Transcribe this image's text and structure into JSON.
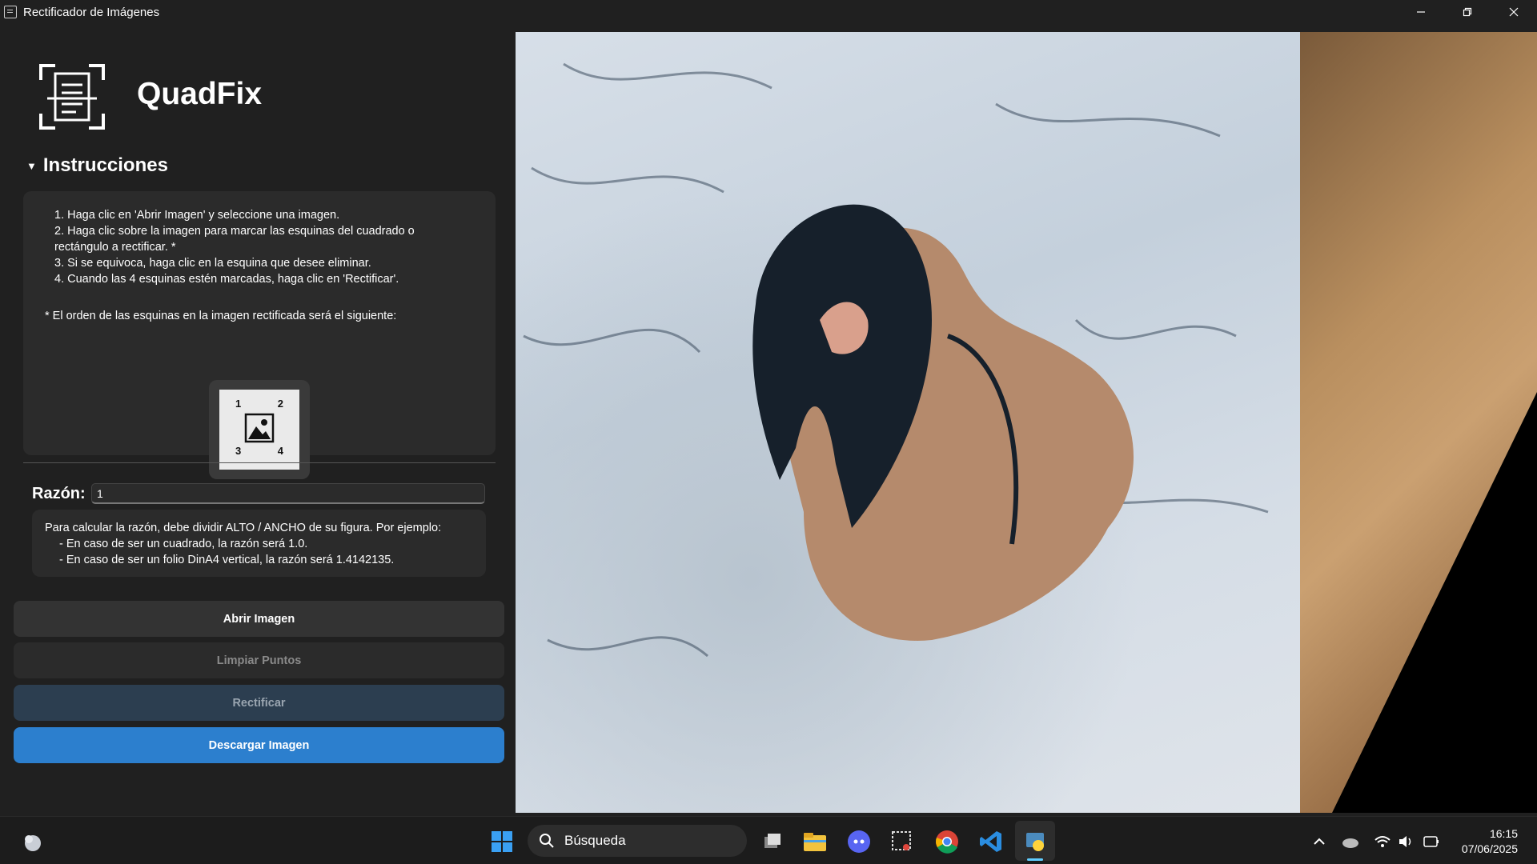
{
  "window": {
    "title": "Rectificador de Imágenes"
  },
  "app": {
    "brand": "QuadFix"
  },
  "instructions": {
    "header": "Instrucciones",
    "steps": [
      "1. Haga clic en 'Abrir Imagen' y seleccione una imagen.",
      "2. Haga clic sobre la imagen para marcar las esquinas del cuadrado o",
      "rectángulo a rectificar. *",
      "3. Si se equivoca, haga clic en la esquina que desee eliminar.",
      "4. Cuando las 4 esquinas estén marcadas, haga clic en 'Rectificar'."
    ],
    "order_note": "* El orden de las esquinas en la imagen rectificada será el siguiente:",
    "corners": [
      "1",
      "2",
      "3",
      "4"
    ]
  },
  "ratio": {
    "label": "Razón:",
    "value": "1",
    "info": [
      "Para calcular la razón, debe dividir ALTO / ANCHO de su figura. Por ejemplo:",
      "-    En caso de ser un cuadrado, la razón será 1.0.",
      "-    En caso de ser un folio DinA4 vertical, la razón será 1.4142135."
    ]
  },
  "buttons": {
    "open": "Abrir Imagen",
    "clear": "Limpiar Puntos",
    "rectify": "Rectificar",
    "download": "Descargar Imagen"
  },
  "taskbar": {
    "search_placeholder": "Búsqueda",
    "time": "16:15",
    "date": "07/06/2025"
  },
  "colors": {
    "accent": "#2c7fce",
    "rectify_bg": "#2c3e50",
    "panel_bg": "#2b2b2b"
  }
}
